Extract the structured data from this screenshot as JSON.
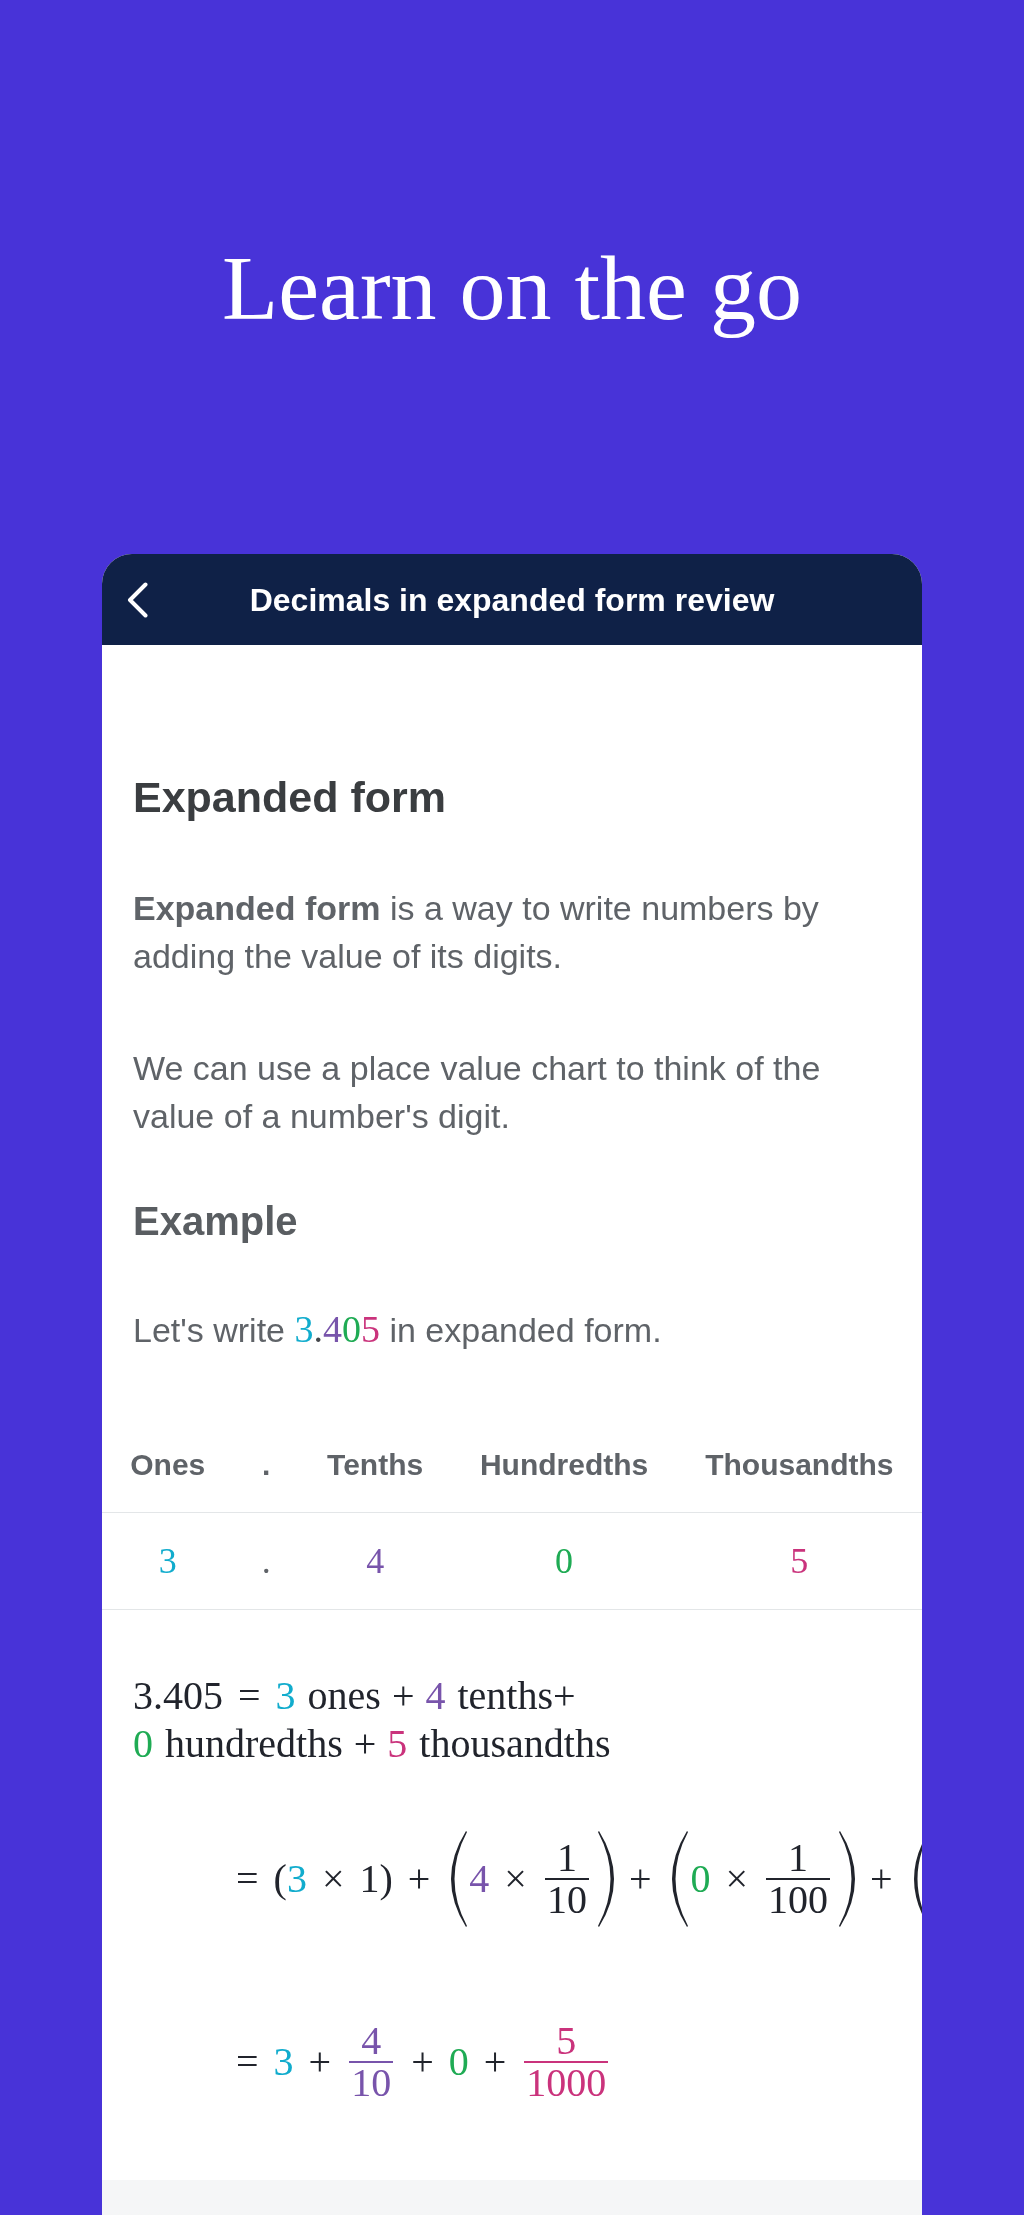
{
  "headline": "Learn on the go",
  "lesson_header": {
    "title": "Decimals in expanded form review"
  },
  "article": {
    "heading": "Expanded form",
    "paragraphs": [
      "**Expanded form** is a way to write numbers by adding the value of its digits.",
      "We can use a place value chart to think of the value of a number's digit."
    ],
    "subheading": "Example",
    "intro": {
      "before": "Let's write",
      "number": [
        {
          "text": "3",
          "color": "#11accd"
        },
        {
          "text": "."
        },
        {
          "text": "4",
          "color": "#7854ab"
        },
        {
          "text": "0",
          "color": "#1fab54"
        },
        {
          "text": "5",
          "color": "#ca337c"
        }
      ],
      "after": "in expanded form."
    }
  },
  "place_value_table": {
    "columns": [
      "Ones",
      ".",
      "Tenths",
      "Hundredths",
      "Thousandths"
    ],
    "rows": [
      [
        {
          "text": "3",
          "color": "#11accd"
        },
        {
          "text": "."
        },
        {
          "text": "4",
          "color": "#7854ab"
        },
        {
          "text": "0",
          "color": "#1fab54"
        },
        {
          "text": "5",
          "color": "#ca337c"
        }
      ]
    ]
  },
  "expansion": {
    "statement": [
      [
        {
          "kind": "sym",
          "text": "3.405"
        },
        {
          "kind": "rel",
          "text": "="
        },
        {
          "kind": "num",
          "text": "3",
          "color": "#11accd"
        },
        {
          "kind": "word",
          "text": "ones"
        },
        {
          "kind": "bin",
          "text": "+"
        },
        {
          "kind": "num",
          "text": "4",
          "color": "#7854ab"
        },
        {
          "kind": "word",
          "text": "tenths+"
        }
      ],
      [
        {
          "kind": "num",
          "text": "0",
          "color": "#1fab54"
        },
        {
          "kind": "word",
          "text": "hundredths"
        },
        {
          "kind": "bin",
          "text": "+"
        },
        {
          "kind": "num",
          "text": "5",
          "color": "#ca337c"
        },
        {
          "kind": "word",
          "text": "thousandths"
        }
      ]
    ],
    "steps": [
      [
        {
          "kind": "rel",
          "text": "="
        },
        {
          "kind": "sym",
          "text": "("
        },
        {
          "kind": "num",
          "text": "3",
          "color": "#11accd"
        },
        {
          "kind": "bin",
          "text": "×"
        },
        {
          "kind": "num",
          "text": "1"
        },
        {
          "kind": "sym",
          "text": ")"
        },
        {
          "kind": "bin",
          "text": "+"
        },
        {
          "kind": "group",
          "children": [
            {
              "kind": "num",
              "text": "4",
              "color": "#7854ab"
            },
            {
              "kind": "bin",
              "text": "×"
            },
            {
              "kind": "frac",
              "num": "1",
              "den": "10"
            }
          ]
        },
        {
          "kind": "bin",
          "text": "+"
        },
        {
          "kind": "group",
          "children": [
            {
              "kind": "num",
              "text": "0",
              "color": "#1fab54"
            },
            {
              "kind": "bin",
              "text": "×"
            },
            {
              "kind": "frac",
              "num": "1",
              "den": "100"
            }
          ]
        },
        {
          "kind": "bin",
          "text": "+"
        },
        {
          "kind": "open"
        }
      ],
      [
        {
          "kind": "rel",
          "text": "="
        },
        {
          "kind": "num",
          "text": "3",
          "color": "#11accd"
        },
        {
          "kind": "bin",
          "text": "+"
        },
        {
          "kind": "frac",
          "num": "4",
          "den": "10",
          "color": "#7854ab"
        },
        {
          "kind": "bin",
          "text": "+"
        },
        {
          "kind": "num",
          "text": "0",
          "color": "#1fab54"
        },
        {
          "kind": "bin",
          "text": "+"
        },
        {
          "kind": "frac",
          "num": "5",
          "den": "1000",
          "color": "#ca337c"
        }
      ]
    ]
  }
}
